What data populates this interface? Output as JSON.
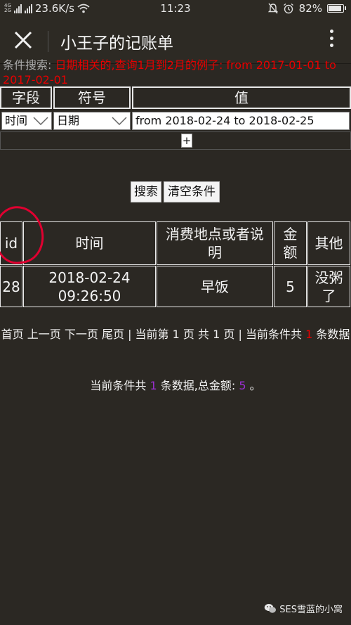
{
  "status_bar": {
    "net_tags": [
      "4G",
      "2G"
    ],
    "speed": "23.6K/s",
    "time": "11:23",
    "battery": "82%",
    "battery_level": 0.82
  },
  "app_bar": {
    "title": "小王子的记账单"
  },
  "hint": {
    "label": "条件搜索:",
    "text": "日期相关的,查询1月到2月的例子: from 2017-01-01 to 2017-02-01"
  },
  "conditions": {
    "headers": {
      "field": "字段",
      "op": "符号",
      "value": "值"
    },
    "row": {
      "field": "时间",
      "op": "日期",
      "value": "from 2018-02-24 to 2018-02-25"
    },
    "add_label": "+"
  },
  "actions": {
    "search": "搜索",
    "clear": "清空条件"
  },
  "table": {
    "headers": {
      "id": "id",
      "time": "时间",
      "place": "消费地点或者说明",
      "amount": "金额",
      "other": "其他"
    },
    "rows": [
      {
        "id": "28",
        "time": "2018-02-24 09:26:50",
        "place": "早饭",
        "amount": "5",
        "other": "没粥了"
      }
    ]
  },
  "pager": {
    "first": "首页",
    "prev": "上一页",
    "next": "下一页",
    "last": "尾页",
    "current_pre": "| 当前第",
    "current_page": "1",
    "total_pre": "页 共",
    "total_pages": "1",
    "count_pre": "页 | 当前条件共",
    "count": "1",
    "count_post": "条数据"
  },
  "summary": {
    "pre": "当前条件共",
    "count": "1",
    "mid": "条数据,总金额:",
    "amount": "5",
    "post": "。"
  },
  "watermark": "SES雪蓝的小窝",
  "colors": {
    "background": "#2b2823",
    "highlight_red": "#e60000",
    "number_purple": "#9a2fd0"
  }
}
